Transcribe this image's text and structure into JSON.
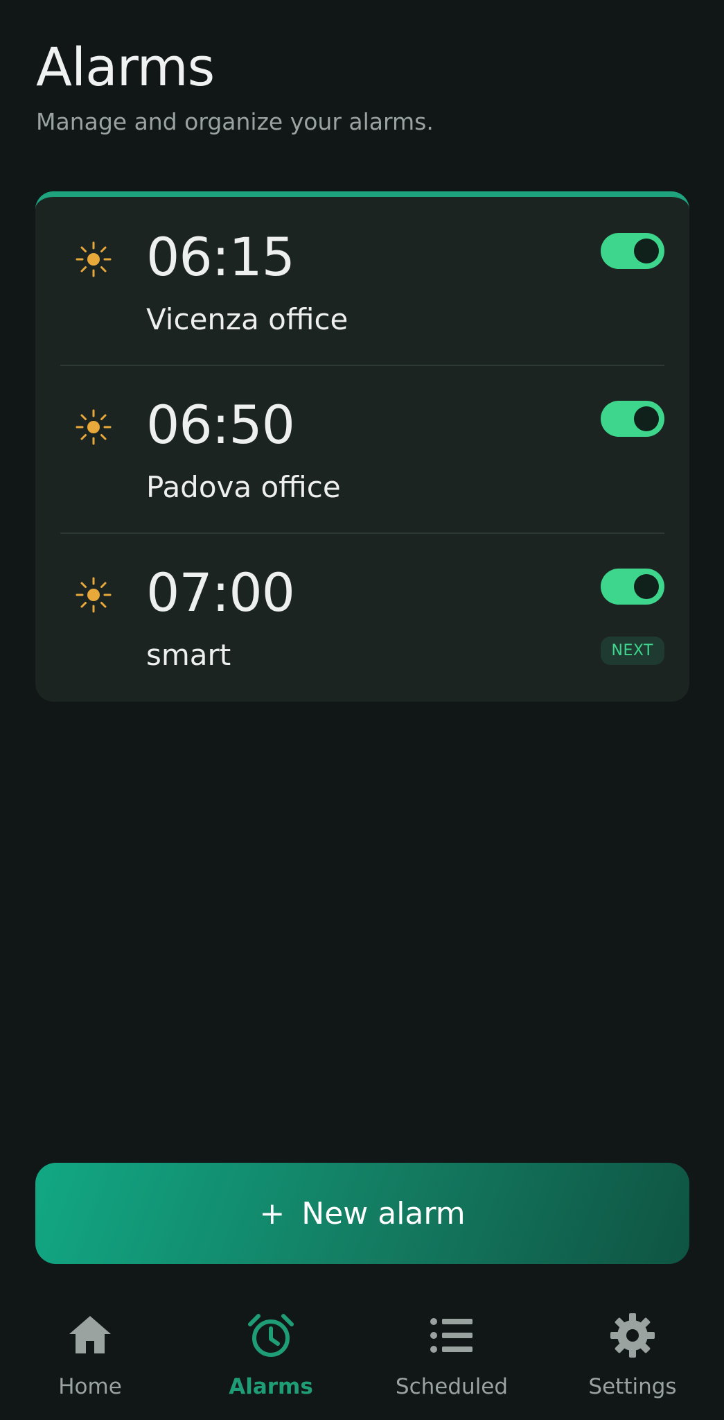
{
  "header": {
    "title": "Alarms",
    "subtitle": "Manage and organize your alarms."
  },
  "alarms": [
    {
      "time": "06:15",
      "label": "Vicenza office",
      "enabled": true,
      "icon": "sun-icon"
    },
    {
      "time": "06:50",
      "label": "Padova office",
      "enabled": true,
      "icon": "sun-icon"
    },
    {
      "time": "07:00",
      "label": "smart",
      "enabled": true,
      "icon": "sun-icon",
      "badge": "NEXT"
    }
  ],
  "actions": {
    "new_alarm_icon": "+",
    "new_alarm_label": "New alarm"
  },
  "nav": {
    "items": [
      {
        "label": "Home",
        "icon": "home-icon",
        "active": false
      },
      {
        "label": "Alarms",
        "icon": "alarm-clock-icon",
        "active": true
      },
      {
        "label": "Scheduled",
        "icon": "list-icon",
        "active": false
      },
      {
        "label": "Settings",
        "icon": "gear-icon",
        "active": false
      }
    ]
  },
  "colors": {
    "background": "#111716",
    "card": "#1c2422",
    "accent": "#3dd68c",
    "accent_dark": "#1f9d77",
    "sun": "#e8a93a"
  }
}
